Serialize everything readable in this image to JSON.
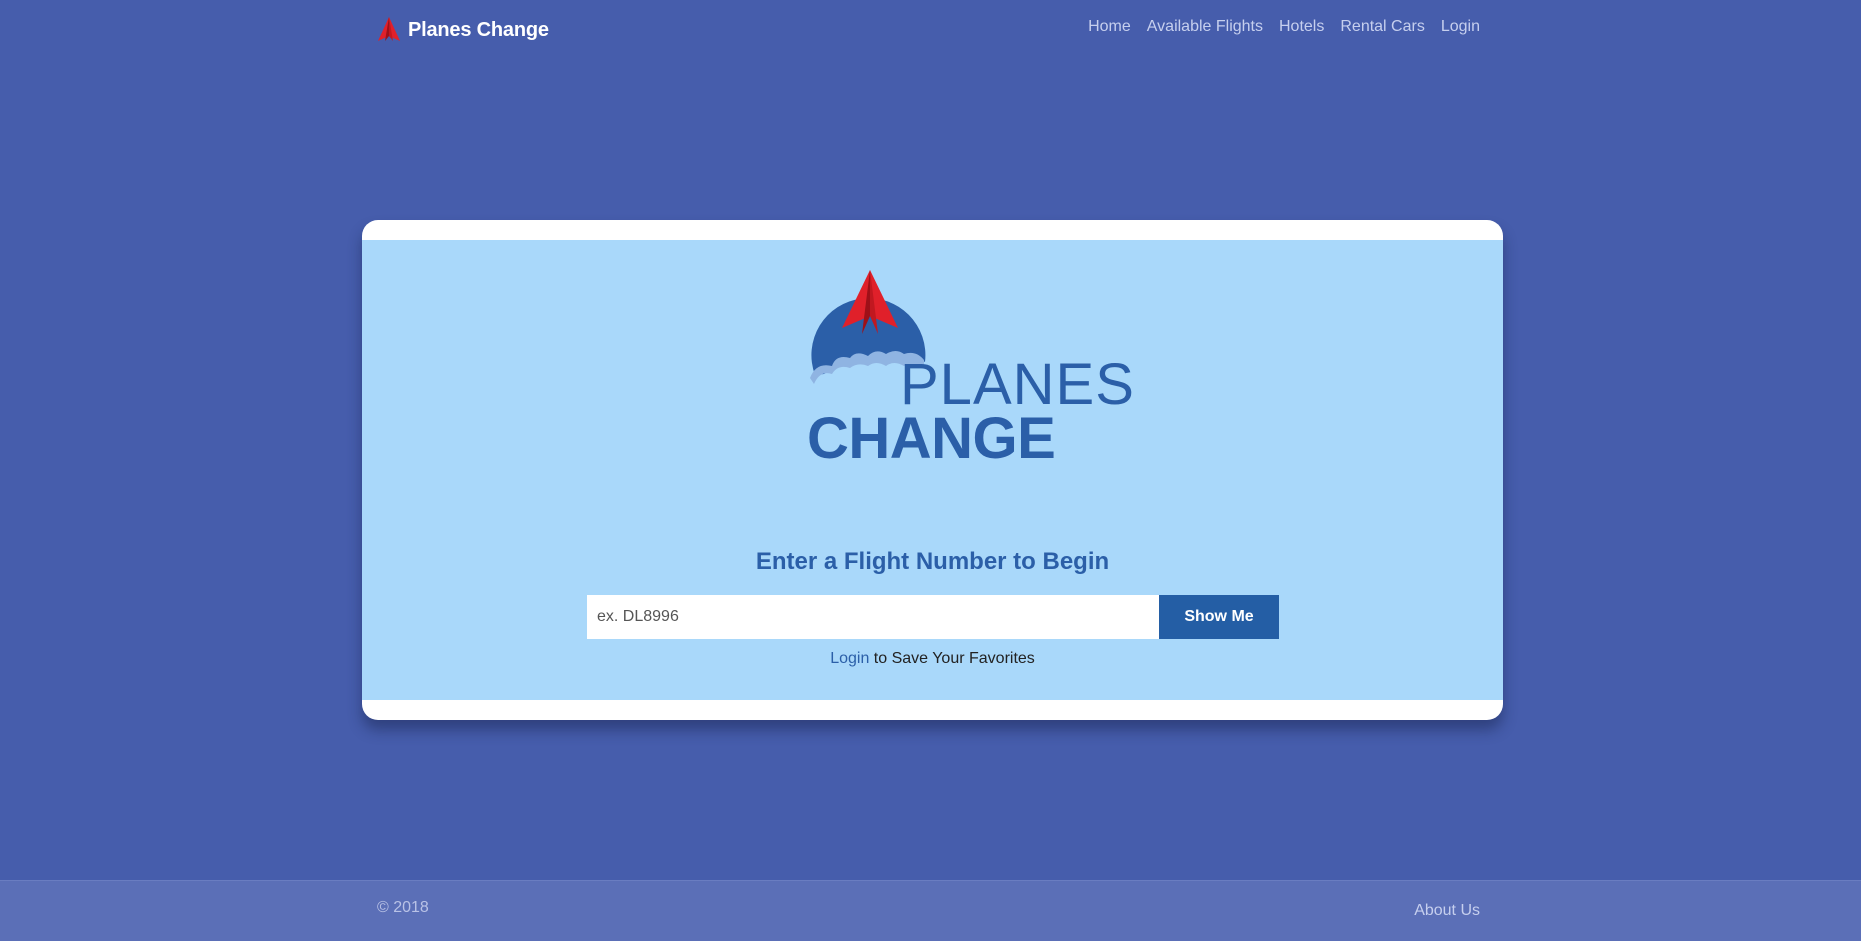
{
  "navbar": {
    "brand_icon": "paper-plane-icon",
    "brand": "Planes Change",
    "links": [
      "Home",
      "Available Flights",
      "Hotels",
      "Rental Cars",
      "Login"
    ]
  },
  "hero": {
    "logo_line1": "PLANES",
    "logo_line2": "CHANGE",
    "heading": "Enter a Flight Number to Begin",
    "input_placeholder": "ex. DL8996",
    "input_value": "",
    "button_label": "Show Me",
    "login_link": "Login",
    "login_suffix": " to Save Your Favorites"
  },
  "footer": {
    "copyright": "© 2018",
    "about": "About Us"
  },
  "colors": {
    "page_bg": "#465dac",
    "card_bg": "#a9d8fa",
    "brand_blue": "#2b5fa8",
    "button": "#245ea5",
    "plane_red": "#e0202a",
    "footer_bg": "#5b6fb7"
  }
}
